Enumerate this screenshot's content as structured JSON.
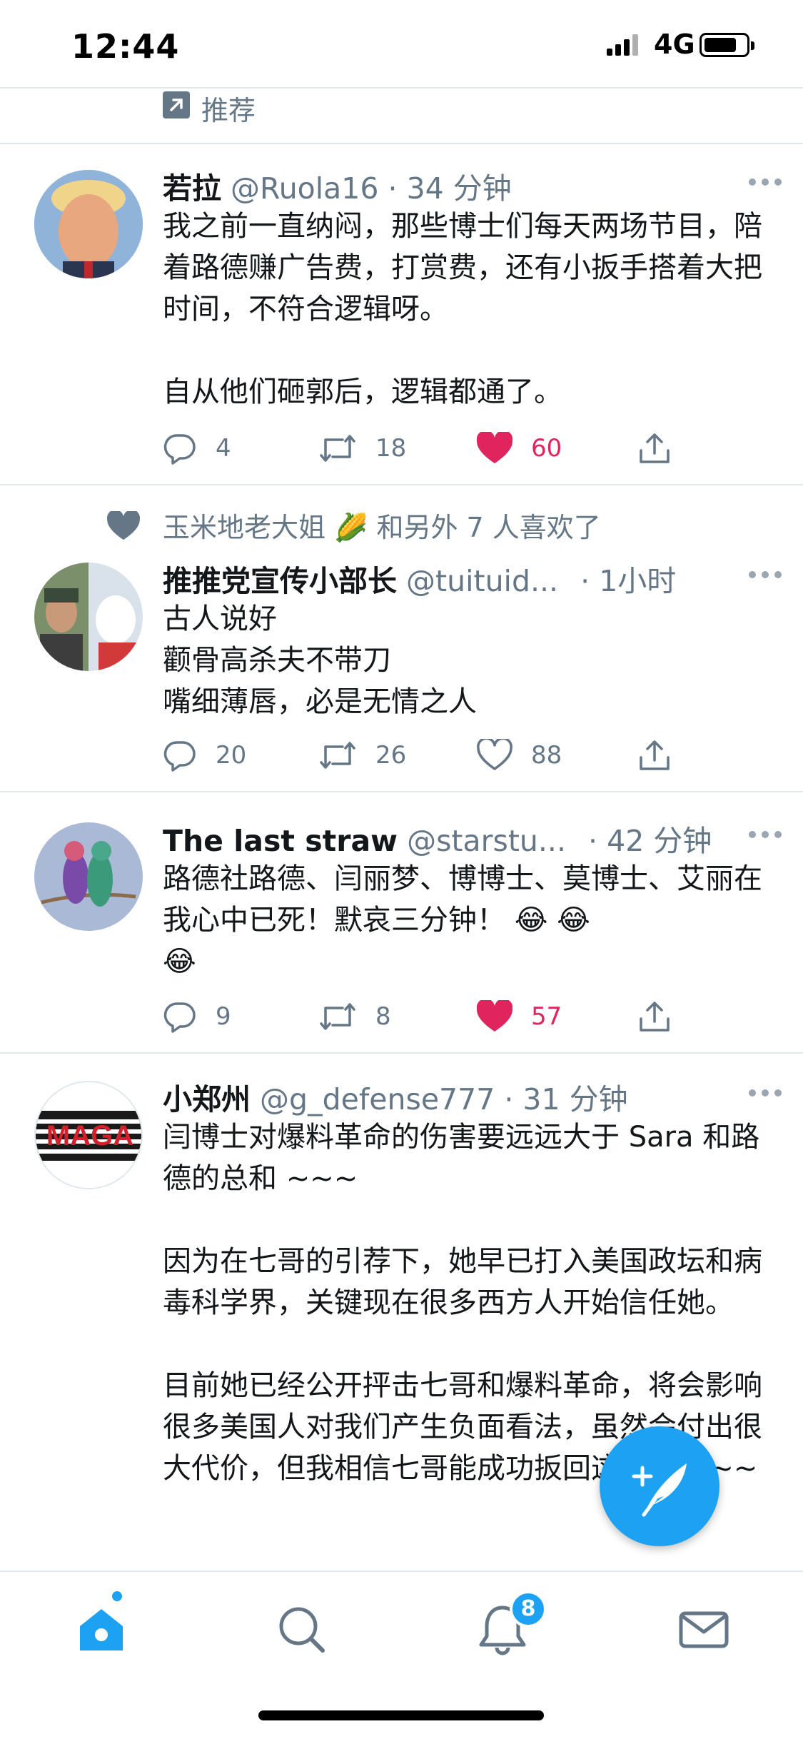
{
  "status_bar": {
    "time": "12:44",
    "network": "4G"
  },
  "recommend": {
    "label": "推荐",
    "icon": "arrow-up-right-icon"
  },
  "tweets": [
    {
      "name": "若拉",
      "handle": "@Ruola16",
      "time": "· 34 分钟",
      "text": "我之前一直纳闷，那些博士们每天两场节目，陪着路德赚广告费，打赏费，还有小扳手搭着大把时间，不符合逻辑呀。\n\n自从他们砸郭后，逻辑都通了。",
      "replies": "4",
      "retweets": "18",
      "likes": "60",
      "liked": true
    },
    {
      "social_context": "玉米地老大姐 🌽 和另外 7 人喜欢了",
      "name": "推推党宣传小部长",
      "handle": "@tuituid...",
      "time": "· 1小时",
      "text": "古人说好\n颧骨高杀夫不带刀\n嘴细薄唇，必是无情之人",
      "replies": "20",
      "retweets": "26",
      "likes": "88",
      "liked": false
    },
    {
      "name": "The last straw",
      "handle": "@starstu...",
      "time": "· 42 分钟",
      "text": "路德社路德、闫丽梦、博博士、莫博士、艾丽在我心中已死！默哀三分钟！ 😂 😂\n😂",
      "replies": "9",
      "retweets": "8",
      "likes": "57",
      "liked": true
    },
    {
      "name": "小郑州",
      "handle": "@g_defense777",
      "time": "· 31 分钟",
      "text": "闫博士对爆料革命的伤害要远远大于 Sara 和路德的总和 ~~~\n\n因为在七哥的引荐下，她早已打入美国政坛和病毒科学界，关键现在很多西方人开始信任她。\n\n目前她已经公开抨击七哥和爆料革命，将会影响很多美国人对我们产生负面看法，虽然会付出很大代价，但我相信七哥能成功扳回这一局 ~~~",
      "avatar_text": "MAGA"
    }
  ],
  "tab_bar": {
    "notifications_badge": "8"
  },
  "colors": {
    "accent": "#1da1f2",
    "like": "#e0245e",
    "secondary_text": "#657786",
    "divider": "#e1e8ed"
  }
}
